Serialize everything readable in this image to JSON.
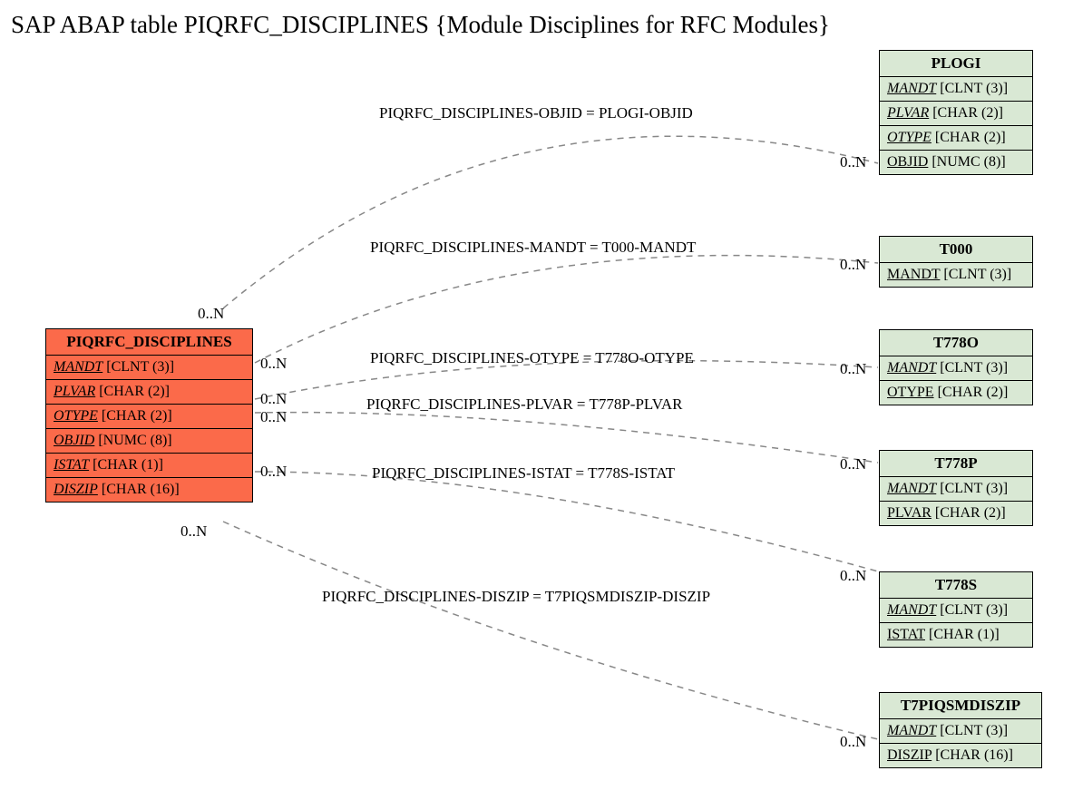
{
  "title": "SAP ABAP table PIQRFC_DISCIPLINES {Module Disciplines for RFC Modules}",
  "mainEntity": {
    "name": "PIQRFC_DISCIPLINES",
    "fields": [
      {
        "name": "MANDT",
        "type": "[CLNT (3)]"
      },
      {
        "name": "PLVAR",
        "type": "[CHAR (2)]"
      },
      {
        "name": "OTYPE",
        "type": "[CHAR (2)]"
      },
      {
        "name": "OBJID",
        "type": "[NUMC (8)]"
      },
      {
        "name": "ISTAT",
        "type": "[CHAR (1)]"
      },
      {
        "name": "DISZIP",
        "type": "[CHAR (16)]"
      }
    ]
  },
  "refEntities": [
    {
      "name": "PLOGI",
      "fields": [
        {
          "name": "MANDT",
          "type": "[CLNT (3)]",
          "italic": true
        },
        {
          "name": "PLVAR",
          "type": "[CHAR (2)]",
          "italic": true
        },
        {
          "name": "OTYPE",
          "type": "[CHAR (2)]",
          "italic": true
        },
        {
          "name": "OBJID",
          "type": "[NUMC (8)]",
          "italic": false
        }
      ]
    },
    {
      "name": "T000",
      "fields": [
        {
          "name": "MANDT",
          "type": "[CLNT (3)]",
          "italic": false
        }
      ]
    },
    {
      "name": "T778O",
      "fields": [
        {
          "name": "MANDT",
          "type": "[CLNT (3)]",
          "italic": true
        },
        {
          "name": "OTYPE",
          "type": "[CHAR (2)]",
          "italic": false
        }
      ]
    },
    {
      "name": "T778P",
      "fields": [
        {
          "name": "MANDT",
          "type": "[CLNT (3)]",
          "italic": true
        },
        {
          "name": "PLVAR",
          "type": "[CHAR (2)]",
          "italic": false
        }
      ]
    },
    {
      "name": "T778S",
      "fields": [
        {
          "name": "MANDT",
          "type": "[CLNT (3)]",
          "italic": true
        },
        {
          "name": "ISTAT",
          "type": "[CHAR (1)]",
          "italic": false
        }
      ]
    },
    {
      "name": "T7PIQSMDISZIP",
      "fields": [
        {
          "name": "MANDT",
          "type": "[CLNT (3)]",
          "italic": true
        },
        {
          "name": "DISZIP",
          "type": "[CHAR (16)]",
          "italic": false
        }
      ]
    }
  ],
  "relations": [
    {
      "label": "PIQRFC_DISCIPLINES-OBJID = PLOGI-OBJID"
    },
    {
      "label": "PIQRFC_DISCIPLINES-MANDT = T000-MANDT"
    },
    {
      "label": "PIQRFC_DISCIPLINES-OTYPE = T778O-OTYPE"
    },
    {
      "label": "PIQRFC_DISCIPLINES-PLVAR = T778P-PLVAR"
    },
    {
      "label": "PIQRFC_DISCIPLINES-ISTAT = T778S-ISTAT"
    },
    {
      "label": "PIQRFC_DISCIPLINES-DISZIP = T7PIQSMDISZIP-DISZIP"
    }
  ],
  "cardinality": "0..N"
}
